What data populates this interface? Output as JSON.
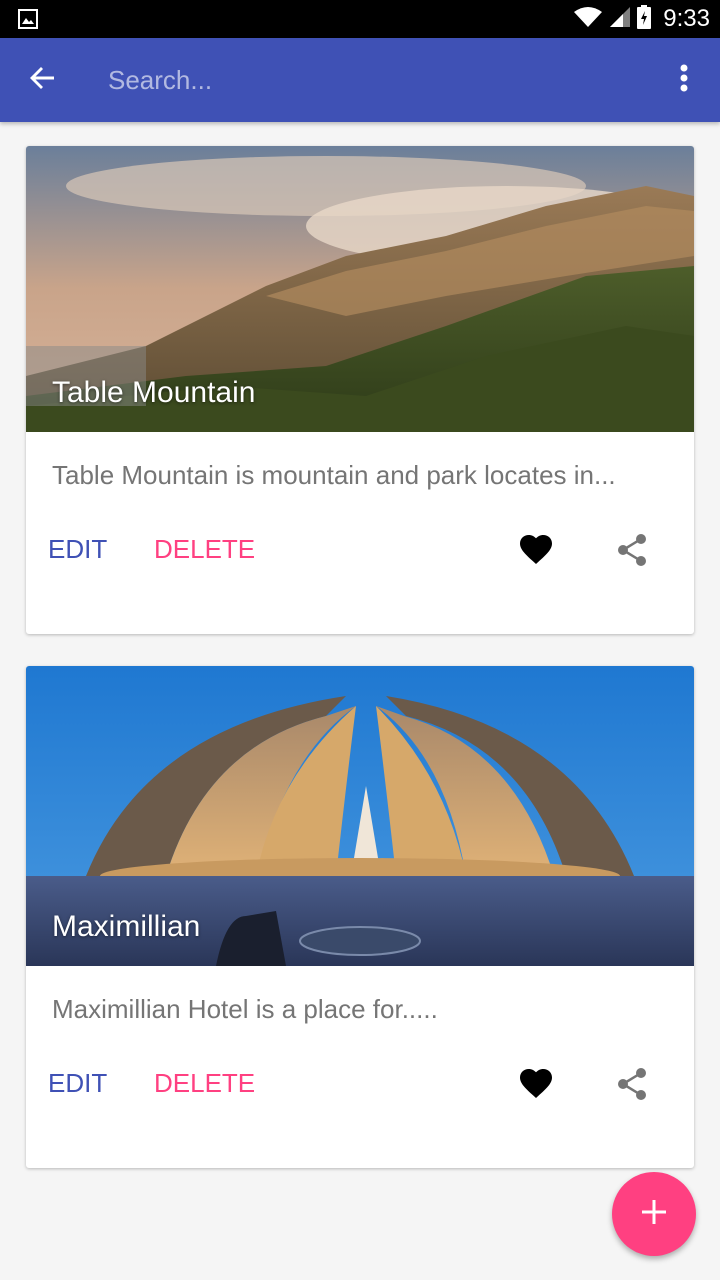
{
  "status_bar": {
    "time": "9:33",
    "icons": [
      "image-notification-icon",
      "wifi-icon",
      "cell-signal-icon",
      "battery-icon"
    ]
  },
  "app_bar": {
    "back_icon": "arrow-back-icon",
    "search": {
      "placeholder": "Search...",
      "value": ""
    },
    "overflow_icon": "more-vert-icon",
    "color": "#3f51b5"
  },
  "cards": [
    {
      "title": "Table Mountain",
      "description": "Table Mountain is mountain and park locates in...",
      "edit_label": "EDIT",
      "delete_label": "DELETE",
      "favorite_icon": "heart-icon",
      "share_icon": "share-icon"
    },
    {
      "title": "Maximillian",
      "description": "Maximillian Hotel is a place for.....",
      "edit_label": "EDIT",
      "delete_label": "DELETE",
      "favorite_icon": "heart-icon",
      "share_icon": "share-icon"
    }
  ],
  "fab": {
    "icon": "add-icon",
    "color": "#ff4081"
  },
  "colors": {
    "primary": "#3f51b5",
    "accent": "#ff4081",
    "background": "#f5f5f5"
  }
}
